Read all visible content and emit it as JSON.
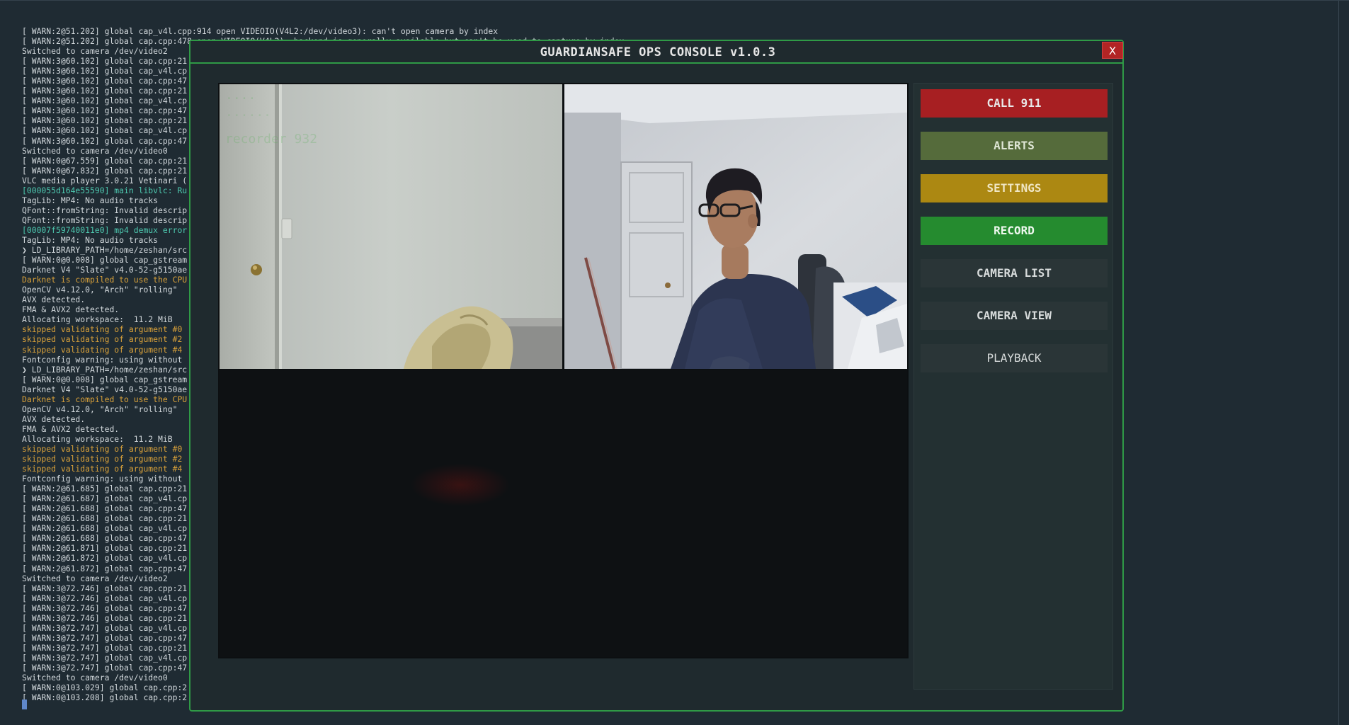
{
  "terminal": {
    "lines": [
      {
        "t": "[ WARN:2@51.202] global cap_v4l.cpp:914 open VIDEOIO(V4L2:/dev/video3): can't open camera by index",
        "c": "n"
      },
      {
        "t": "[ WARN:2@51.202] global cap.cpp:478 open VIDEOIO(V4L2): backend is generally available but can't be used to capture by index",
        "c": "n"
      },
      {
        "t": "Switched to camera /dev/video2",
        "c": "n"
      },
      {
        "t": "[ WARN:3@60.102] global cap.cpp:21",
        "c": "n"
      },
      {
        "t": "[ WARN:3@60.102] global cap_v4l.cp",
        "c": "n"
      },
      {
        "t": "[ WARN:3@60.102] global cap.cpp:47",
        "c": "n"
      },
      {
        "t": "[ WARN:3@60.102] global cap.cpp:21",
        "c": "n"
      },
      {
        "t": "[ WARN:3@60.102] global cap_v4l.cp",
        "c": "n"
      },
      {
        "t": "[ WARN:3@60.102] global cap.cpp:47",
        "c": "n"
      },
      {
        "t": "[ WARN:3@60.102] global cap.cpp:21",
        "c": "n"
      },
      {
        "t": "[ WARN:3@60.102] global cap_v4l.cp",
        "c": "n"
      },
      {
        "t": "[ WARN:3@60.102] global cap.cpp:47",
        "c": "n"
      },
      {
        "t": "Switched to camera /dev/video0",
        "c": "n"
      },
      {
        "t": "[ WARN:0@67.559] global cap.cpp:21",
        "c": "n"
      },
      {
        "t": "[ WARN:0@67.832] global cap.cpp:21",
        "c": "n"
      },
      {
        "t": "VLC media player 3.0.21 Vetinari (",
        "c": "n"
      },
      {
        "t": "[000055d164e55590] main libvlc: Ru",
        "c": "a"
      },
      {
        "t": "TagLib: MP4: No audio tracks",
        "c": "n"
      },
      {
        "t": "QFont::fromString: Invalid descrip",
        "c": "n"
      },
      {
        "t": "QFont::fromString: Invalid descrip",
        "c": "n"
      },
      {
        "t": "[00007f59740011e0] mp4 demux error",
        "c": "a"
      },
      {
        "t": "TagLib: MP4: No audio tracks",
        "c": "n"
      },
      {
        "t": "❯ LD_LIBRARY_PATH=/home/zeshan/src",
        "c": "p"
      },
      {
        "t": "[ WARN:0@0.008] global cap_gstream",
        "c": "n"
      },
      {
        "t": "Darknet V4 \"Slate\" v4.0-52-g5150ae",
        "c": "n"
      },
      {
        "t": "Darknet is compiled to use the CPU",
        "c": "w"
      },
      {
        "t": "OpenCV v4.12.0, \"Arch\" \"rolling\"",
        "c": "n"
      },
      {
        "t": "AVX detected.",
        "c": "n"
      },
      {
        "t": "FMA & AVX2 detected.",
        "c": "n"
      },
      {
        "t": "Allocating workspace:  11.2 MiB",
        "c": "n"
      },
      {
        "t": "skipped validating of argument #0",
        "c": "w"
      },
      {
        "t": "skipped validating of argument #2",
        "c": "w"
      },
      {
        "t": "skipped validating of argument #4",
        "c": "w"
      },
      {
        "t": "Fontconfig warning: using without",
        "c": "n"
      },
      {
        "t": "❯ LD_LIBRARY_PATH=/home/zeshan/src",
        "c": "p"
      },
      {
        "t": "[ WARN:0@0.008] global cap_gstream",
        "c": "n"
      },
      {
        "t": "Darknet V4 \"Slate\" v4.0-52-g5150ae",
        "c": "n"
      },
      {
        "t": "Darknet is compiled to use the CPU",
        "c": "w"
      },
      {
        "t": "OpenCV v4.12.0, \"Arch\" \"rolling\"",
        "c": "n"
      },
      {
        "t": "AVX detected.",
        "c": "n"
      },
      {
        "t": "FMA & AVX2 detected.",
        "c": "n"
      },
      {
        "t": "Allocating workspace:  11.2 MiB",
        "c": "n"
      },
      {
        "t": "skipped validating of argument #0",
        "c": "w"
      },
      {
        "t": "skipped validating of argument #2",
        "c": "w"
      },
      {
        "t": "skipped validating of argument #4",
        "c": "w"
      },
      {
        "t": "Fontconfig warning: using without",
        "c": "n"
      },
      {
        "t": "[ WARN:2@61.685] global cap.cpp:21",
        "c": "n"
      },
      {
        "t": "[ WARN:2@61.687] global cap_v4l.cp",
        "c": "n"
      },
      {
        "t": "[ WARN:2@61.688] global cap.cpp:47",
        "c": "n"
      },
      {
        "t": "[ WARN:2@61.688] global cap.cpp:21",
        "c": "n"
      },
      {
        "t": "[ WARN:2@61.688] global cap_v4l.cp",
        "c": "n"
      },
      {
        "t": "[ WARN:2@61.688] global cap.cpp:47",
        "c": "n"
      },
      {
        "t": "[ WARN:2@61.871] global cap.cpp:21",
        "c": "n"
      },
      {
        "t": "[ WARN:2@61.872] global cap_v4l.cp",
        "c": "n"
      },
      {
        "t": "[ WARN:2@61.872] global cap.cpp:47",
        "c": "n"
      },
      {
        "t": "Switched to camera /dev/video2",
        "c": "n"
      },
      {
        "t": "[ WARN:3@72.746] global cap.cpp:21",
        "c": "n"
      },
      {
        "t": "[ WARN:3@72.746] global cap_v4l.cp",
        "c": "n"
      },
      {
        "t": "[ WARN:3@72.746] global cap.cpp:47",
        "c": "n"
      },
      {
        "t": "[ WARN:3@72.746] global cap.cpp:21",
        "c": "n"
      },
      {
        "t": "[ WARN:3@72.747] global cap_v4l.cp",
        "c": "n"
      },
      {
        "t": "[ WARN:3@72.747] global cap.cpp:47",
        "c": "n"
      },
      {
        "t": "[ WARN:3@72.747] global cap.cpp:21",
        "c": "n"
      },
      {
        "t": "[ WARN:3@72.747] global cap_v4l.cp",
        "c": "n"
      },
      {
        "t": "[ WARN:3@72.747] global cap.cpp:47",
        "c": "n"
      },
      {
        "t": "Switched to camera /dev/video0",
        "c": "n"
      },
      {
        "t": "[ WARN:0@103.029] global cap.cpp:2",
        "c": "n"
      },
      {
        "t": "[ WARN:0@103.208] global cap.cpp:2",
        "c": "n"
      }
    ]
  },
  "dialog": {
    "title": "GUARDIANSAFE OPS CONSOLE v1.0.3",
    "close_label": "X"
  },
  "cameras": {
    "cam1_overlay_faint": "recorder 932"
  },
  "sidebar": {
    "call_label": "CALL 911",
    "alerts_label": "ALERTS",
    "settings_label": "SETTINGS",
    "record_label": "RECORD",
    "camera_list_label": "CAMERA LIST",
    "camera_view_label": "CAMERA VIEW",
    "playback_label": "PLAYBACK"
  },
  "colors": {
    "accent_border": "#2f9a46",
    "call": "#a71f22",
    "alerts": "#556b3b",
    "settings": "#ac8812",
    "record": "#258b2f"
  }
}
